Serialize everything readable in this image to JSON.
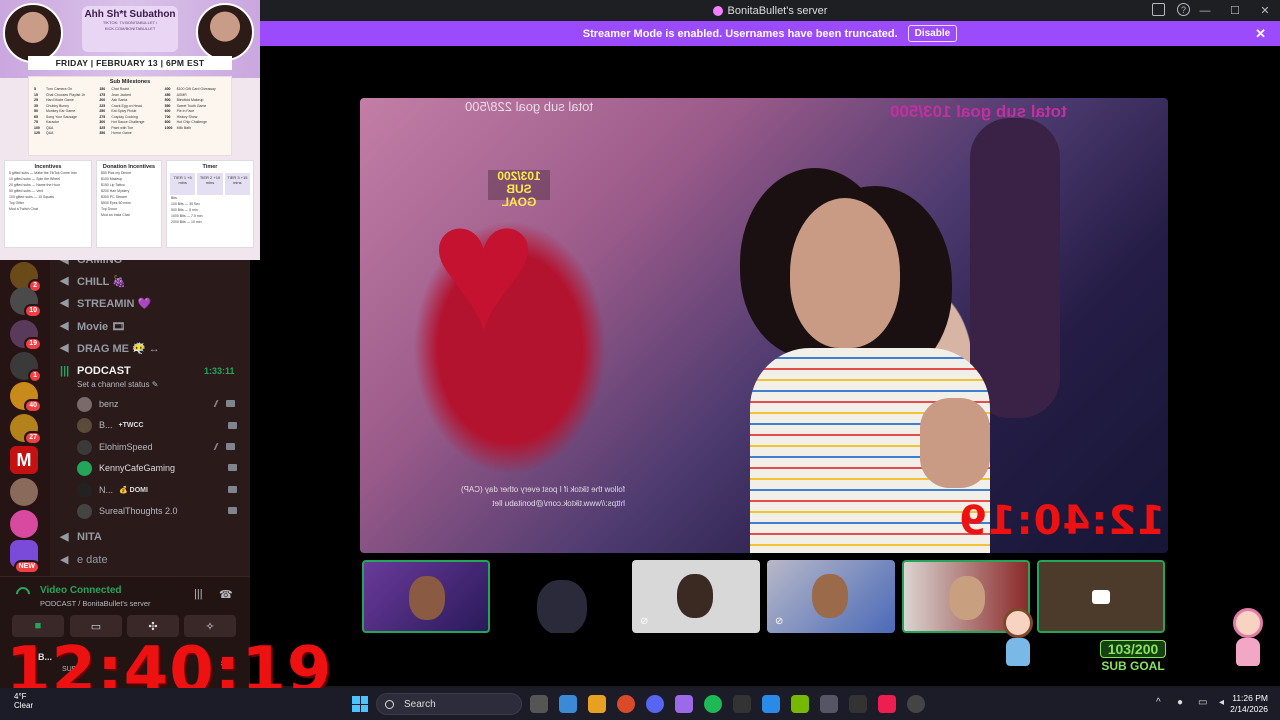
{
  "window": {
    "title": "BonitaBullet's server"
  },
  "banner": {
    "text": "Streamer Mode is enabled. Usernames have been truncated.",
    "disable_label": "Disable",
    "color": "#9b4bfb"
  },
  "poster": {
    "title": "Ahh Sh*t Subathon",
    "socials": "TIKTOK: TV.BONITABULLET / KICK.COM/BONITABULLET",
    "date": "FRIDAY | FEBRUARY 13 | 6PM EST",
    "milestones_title": "Sub Milestones",
    "milestones": [
      [
        "5",
        "Turn Camera On"
      ],
      [
        "15",
        "Chat Chooses Playlist 1h"
      ],
      [
        "25",
        "Hard Mode Game"
      ],
      [
        "35",
        "Chubby Bunny"
      ],
      [
        "50",
        "Monkey Ear Game"
      ],
      [
        "65",
        "Song Your Sausage"
      ],
      [
        "75",
        "Karaoke"
      ],
      [
        "100",
        "Q&A"
      ],
      [
        "125",
        "Q&A"
      ],
      [
        "150",
        "Chat Roast"
      ],
      [
        "175",
        "Jean Jacked"
      ],
      [
        "200",
        "Ask Santa"
      ],
      [
        "225",
        "Crack Egg on Head"
      ],
      [
        "250",
        "Eat Spicy Pickle"
      ],
      [
        "275",
        "Cosplay Cooking"
      ],
      [
        "300",
        "Hot Sauce Challenge"
      ],
      [
        "325",
        "Paint with Toe"
      ],
      [
        "350",
        "Horror Game"
      ],
      [
        "400",
        "$100 Gift Card Giveaway"
      ],
      [
        "450",
        "ASMR"
      ],
      [
        "500",
        "Blindfold Makeup"
      ],
      [
        "550",
        "Sweet Tooth Game"
      ],
      [
        "600",
        "Pie in Face"
      ],
      [
        "700",
        "History Show"
      ],
      [
        "800",
        "Hot Chip Challenge"
      ],
      [
        "1000",
        "Milk Bath"
      ]
    ],
    "incentives_title": "Incentives",
    "incentives": [
      "5 gifted subs — Make the TikTok Come Into",
      "10 gifted subs — Spin the Wheel",
      "20 gifted subs — Name the Hour",
      "50 gifted subs — Vent",
      "100 gifted subs — 10 Squats",
      "Top Gifter",
      "Mod a Twitch Chat"
    ],
    "donation_title": "Donation Incentives",
    "donations": [
      "$50 Pick my Dinner",
      "$100 Makeup",
      "$150 Lip Tattoo",
      "$200 Hair Mystery",
      "$300 PC Stream",
      "$500 Eyes 50 mins",
      "Top Donor",
      "Mod an Insta Chat"
    ],
    "timer_title": "Timer",
    "tiers": [
      "TIER 1 +5 mins",
      "TIER 2 +10 mins",
      "TIER 3 +15 mins"
    ],
    "bits": [
      "Bits",
      "100 Bits — 30 Sec",
      "500 Bits — 5 min",
      "1000 Bits — 7.5 min",
      "2000 Bits — 10 min"
    ]
  },
  "sidebar": {
    "channels": [
      {
        "name": "GAMING",
        "icon": "speaker-icon"
      },
      {
        "name": "CHILL 🍇",
        "icon": "speaker-icon"
      },
      {
        "name": "STREAMIN 💜",
        "icon": "speaker-icon"
      },
      {
        "name": "Movie 🎞",
        "icon": "speaker-icon"
      },
      {
        "name": "DRAG ME 😶‍🌫️ ↔",
        "icon": "speaker-icon"
      },
      {
        "name": "PODCAST",
        "icon": "voice-active-icon",
        "timer": "1:33:11",
        "status": "Set a channel status ✎"
      },
      {
        "name": "NITA",
        "icon": "speaker-icon"
      },
      {
        "name": "e date",
        "icon": "speaker-icon"
      }
    ],
    "podcast_users": [
      {
        "name": "benz",
        "tag": "",
        "color": "#7a6a6a"
      },
      {
        "name": "B...",
        "tag": "+TWCC",
        "color": "#5a4a3a"
      },
      {
        "name": "ElohimSpeed",
        "tag": "",
        "color": "#3a3a3a"
      },
      {
        "name": "KennyCafeGaming",
        "tag": "",
        "color": "#23a55a"
      },
      {
        "name": "N...",
        "tag": "💰 DOMI",
        "color": "#222"
      },
      {
        "name": "SurealThoughts 2.0",
        "tag": "",
        "color": "#444"
      }
    ],
    "server_badges": [
      "2",
      "10",
      "19",
      "1",
      "40",
      "27",
      "NEW"
    ]
  },
  "voice": {
    "status": "Video Connected",
    "location": "PODCAST / BonitaBullet's server"
  },
  "userbar": {
    "name": "B...",
    "sub": "SUB...",
    "clock_overlay": "12:40:19"
  },
  "stage": {
    "goal_left": "total sub goal 228/500",
    "goal_right": "total sub goal 103/500",
    "subgoal_small": "103/200 SUB GOAL",
    "clock_mirror": "12:40:19",
    "chat_mirror": "follow the tiktok if I post every other day (CAP) https://www.tiktok.com/@bonitabu llet"
  },
  "subgoal": {
    "value": "103/200",
    "label": "SUB GOAL"
  },
  "taskbar": {
    "weather_temp": "4°F",
    "weather_desc": "Clear",
    "search_label": "Search",
    "time": "11:26 PM",
    "date": "2/14/2026"
  }
}
